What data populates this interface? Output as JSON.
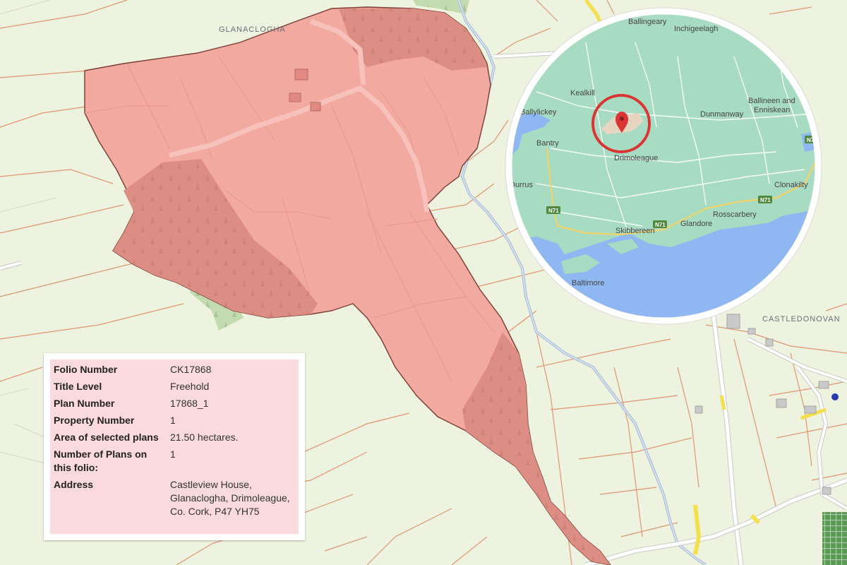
{
  "map": {
    "place_labels": {
      "glanaclogha": "GLANACLOGHA",
      "castledonovan": "CASTLEDONOVAN"
    }
  },
  "inset": {
    "towns": {
      "ballingeary": "Ballingeary",
      "inchigeelagh": "Inchigeelagh",
      "kealkill": "Kealkill",
      "ballylickey": "Ballylickey",
      "bantry": "Bantry",
      "drimoleague": "Drimoleague",
      "dunmanway": "Dunmanway",
      "ballineen": "Ballineen and",
      "enniskean": "Enniskean",
      "durrus": "Durrus",
      "clonakilty": "Clonakilty",
      "rosscarbery": "Rosscarbery",
      "glandore": "Glandore",
      "skibbereen": "Skibbereen",
      "baltimore": "Baltimore"
    },
    "road_shields": {
      "n71_a": "N71",
      "n71_b": "N71",
      "n71_c": "N71",
      "n71_d": "N71"
    }
  },
  "info": {
    "rows": [
      {
        "label": "Folio Number",
        "value": "CK17868"
      },
      {
        "label": "Title Level",
        "value": "Freehold"
      },
      {
        "label": "Plan Number",
        "value": "17868_1"
      },
      {
        "label": "Property Number",
        "value": "1"
      },
      {
        "label": "Area of selected plans",
        "value": "21.50 hectares."
      },
      {
        "label": "Number of Plans on this folio:",
        "value": "1"
      },
      {
        "label": "Address",
        "value": "Castleview House, Glanaclogha, Drimoleague, Co. Cork, P47 YH75"
      }
    ]
  },
  "colors": {
    "background": "#eef3df",
    "parcel_fill": "#f2a9a0",
    "parcel_forest": "#dd8e84",
    "parcel_border": "#7a3b32",
    "field_boundary": "#e08a6a",
    "forest_green": "#c4dbb0",
    "river": "#9fb8d8",
    "inset_land": "#a8dcc2",
    "inset_sea": "#8fb8f3",
    "inset_ring": "#ffffff",
    "marker_red": "#d93535",
    "road_yellow": "#f4e04d"
  }
}
